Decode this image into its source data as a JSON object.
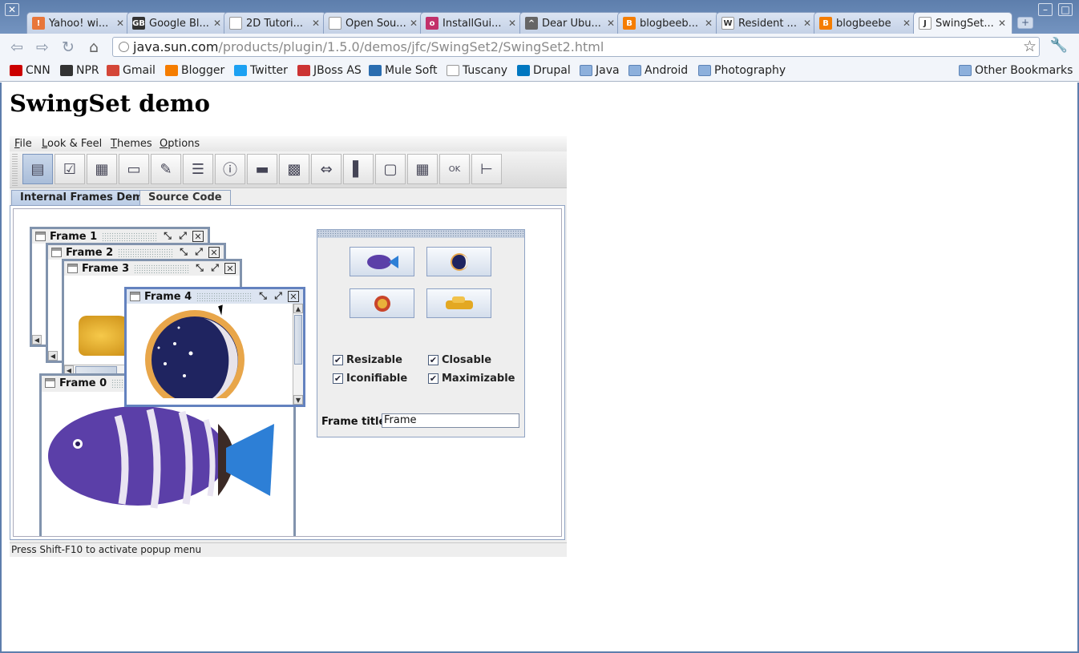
{
  "browser": {
    "tabs": [
      {
        "title": "Yahoo! wi...",
        "favicon_color": "#e8763a",
        "glyph": "!"
      },
      {
        "title": "Google Bl...",
        "favicon_color": "#333333",
        "glyph": "GB"
      },
      {
        "title": "2D Tutori...",
        "favicon_color": "#ffffff",
        "glyph": ""
      },
      {
        "title": "Open Sou...",
        "favicon_color": "#ffffff",
        "glyph": ""
      },
      {
        "title": "InstallGui...",
        "favicon_color": "#c2306a",
        "glyph": "o"
      },
      {
        "title": "Dear Ubu...",
        "favicon_color": "#666666",
        "glyph": "^"
      },
      {
        "title": "blogbeeb...",
        "favicon_color": "#f57d00",
        "glyph": "B"
      },
      {
        "title": "Resident ...",
        "favicon_color": "#ffffff",
        "glyph": "W"
      },
      {
        "title": "blogbeebe",
        "favicon_color": "#f57d00",
        "glyph": "B"
      },
      {
        "title": "SwingSet...",
        "favicon_color": "#ffffff",
        "glyph": "J"
      }
    ],
    "new_tab_label": "+",
    "window_close": "✕",
    "window_minimize": "–",
    "window_maximize": "□",
    "url_host": "java.sun.com",
    "url_path": "/products/plugin/1.5.0/demos/jfc/SwingSet2/SwingSet2.html",
    "nav_icons": [
      "back-icon",
      "forward-icon",
      "reload-icon",
      "home-icon"
    ],
    "star_glyph": "☆",
    "wrench_glyph": "🔧"
  },
  "bookmarks": [
    {
      "label": "CNN",
      "icon": "#cc0000"
    },
    {
      "label": "NPR",
      "icon": "#333333"
    },
    {
      "label": "Gmail",
      "icon": "#d44638"
    },
    {
      "label": "Blogger",
      "icon": "#f57d00"
    },
    {
      "label": "Twitter",
      "icon": "#1da1f2"
    },
    {
      "label": "JBoss AS",
      "icon": "#cc3333"
    },
    {
      "label": "Mule Soft",
      "icon": "#2a6db0"
    },
    {
      "label": "Tuscany",
      "icon": "#ffffff"
    },
    {
      "label": "Drupal",
      "icon": "#0077c0"
    },
    {
      "label": "Java",
      "icon": "folder"
    },
    {
      "label": "Android",
      "icon": "folder"
    },
    {
      "label": "Photography",
      "icon": "folder"
    }
  ],
  "other_bookmarks": "Other Bookmarks",
  "page": {
    "heading": "SwingSet demo"
  },
  "applet": {
    "menus": [
      {
        "label": "File",
        "mnemonic": "F",
        "rest": "ile"
      },
      {
        "label": "Look & Feel",
        "mnemonic": "L",
        "rest": "ook & Feel"
      },
      {
        "label": "Themes",
        "mnemonic": "T",
        "rest": "hemes"
      },
      {
        "label": "Options",
        "mnemonic": "O",
        "rest": "ptions"
      }
    ],
    "toolbar_buttons": [
      "internal-frames-icon",
      "buttons-icon",
      "color-chooser-icon",
      "combobox-icon",
      "editor-pane-icon",
      "file-chooser-icon",
      "option-pane-icon",
      "progress-bar-icon",
      "scroll-pane-icon",
      "slider-icon",
      "split-pane-icon",
      "tabbed-pane-icon",
      "table-icon",
      "tooltip-icon",
      "tree-icon"
    ],
    "tabs": [
      "Internal Frames Demo",
      "Source Code"
    ],
    "frames": {
      "frame1": "Frame 1",
      "frame2": "Frame 2",
      "frame3": "Frame 3",
      "frame4": "Frame 4",
      "frame0": "Frame 0"
    },
    "control_panel": {
      "image_buttons": [
        "fish-icon",
        "moon-icon",
        "sun-icon",
        "car-icon"
      ],
      "checkboxes": [
        {
          "label": "Resizable",
          "checked": true
        },
        {
          "label": "Closable",
          "checked": true
        },
        {
          "label": "Iconifiable",
          "checked": true
        },
        {
          "label": "Maximizable",
          "checked": true
        }
      ],
      "frame_title_label": "Frame title:",
      "frame_title_value": "Frame"
    },
    "status": "Press Shift-F10 to activate popup menu",
    "colors": {
      "accent": "#6382bf",
      "frame_border": "#8193ad"
    }
  }
}
